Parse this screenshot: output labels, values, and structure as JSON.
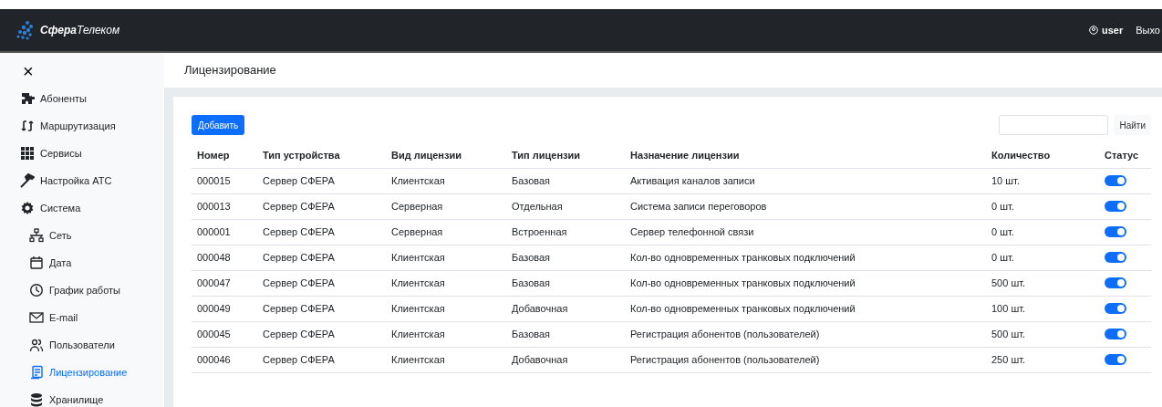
{
  "header": {
    "logo": "**Сфера**Телеком",
    "user": "user",
    "logout": "Выхо"
  },
  "sidebar": {
    "close": "×",
    "items": [
      {
        "label": "Абоненты",
        "selected": false
      },
      {
        "label": "Маршрутизация",
        "selected": false
      },
      {
        "label": "Сервисы",
        "selected": false
      },
      {
        "label": "Настройка АТС",
        "selected": false
      },
      {
        "label": "Система",
        "selected": false,
        "children": [
          {
            "label": "Сеть",
            "selected": false
          },
          {
            "label": "Дата",
            "selected": false
          },
          {
            "label": "График работы",
            "selected": false
          },
          {
            "label": "E-mail",
            "selected": false
          },
          {
            "label": "Пользователи",
            "selected": false
          },
          {
            "label": "Лицензирование",
            "selected": true
          },
          {
            "label": "Хранилище",
            "selected": false
          }
        ]
      }
    ]
  },
  "page_title": "Лицензирование",
  "add_button": "Добавить",
  "search": {
    "button": "Найти"
  },
  "table": {
    "columns": [
      "Номер",
      "Тип устройства",
      "Вид лицензии",
      "Тип лицензии",
      "Назначение лицензии",
      "Количество",
      "Статус"
    ],
    "rows": [
      {
        "cells": [
          "000015",
          "Сервер СФЕРА",
          "Клиентская",
          "Базовая",
          "Активация каналов записи",
          "10 шт."
        ],
        "on": true
      },
      {
        "cells": [
          "000013",
          "Сервер СФЕРА",
          "Серверная",
          "Отдельная",
          "Система записи переговоров",
          "0 шт."
        ],
        "on": true
      },
      {
        "cells": [
          "000001",
          "Сервер СФЕРА",
          "Серверная",
          "Встроенная",
          "Сервер телефонной связи",
          "0 шт."
        ],
        "on": true
      },
      {
        "cells": [
          "000048",
          "Сервер СФЕРА",
          "Клиентская",
          "Базовая",
          "Кол-во одновременных транковых подключений",
          "0 шт."
        ],
        "on": true
      },
      {
        "cells": [
          "000047",
          "Сервер СФЕРА",
          "Клиентская",
          "Базовая",
          "Кол-во одновременных транковых подключений",
          "500 шт."
        ],
        "on": true
      },
      {
        "cells": [
          "000049",
          "Сервер СФЕРА",
          "Клиентская",
          "Добавочная",
          "Кол-во одновременных транковых подключений",
          "100 шт."
        ],
        "on": true
      },
      {
        "cells": [
          "000045",
          "Сервер СФЕРА",
          "Клиентская",
          "Базовая",
          "Регистрация абонентов (пользователей)",
          "500 шт."
        ],
        "on": true
      },
      {
        "cells": [
          "000046",
          "Сервер СФЕРА",
          "Клиентская",
          "Добавочная",
          "Регистрация абонентов (пользователей)",
          "250 шт."
        ],
        "on": true
      }
    ]
  }
}
